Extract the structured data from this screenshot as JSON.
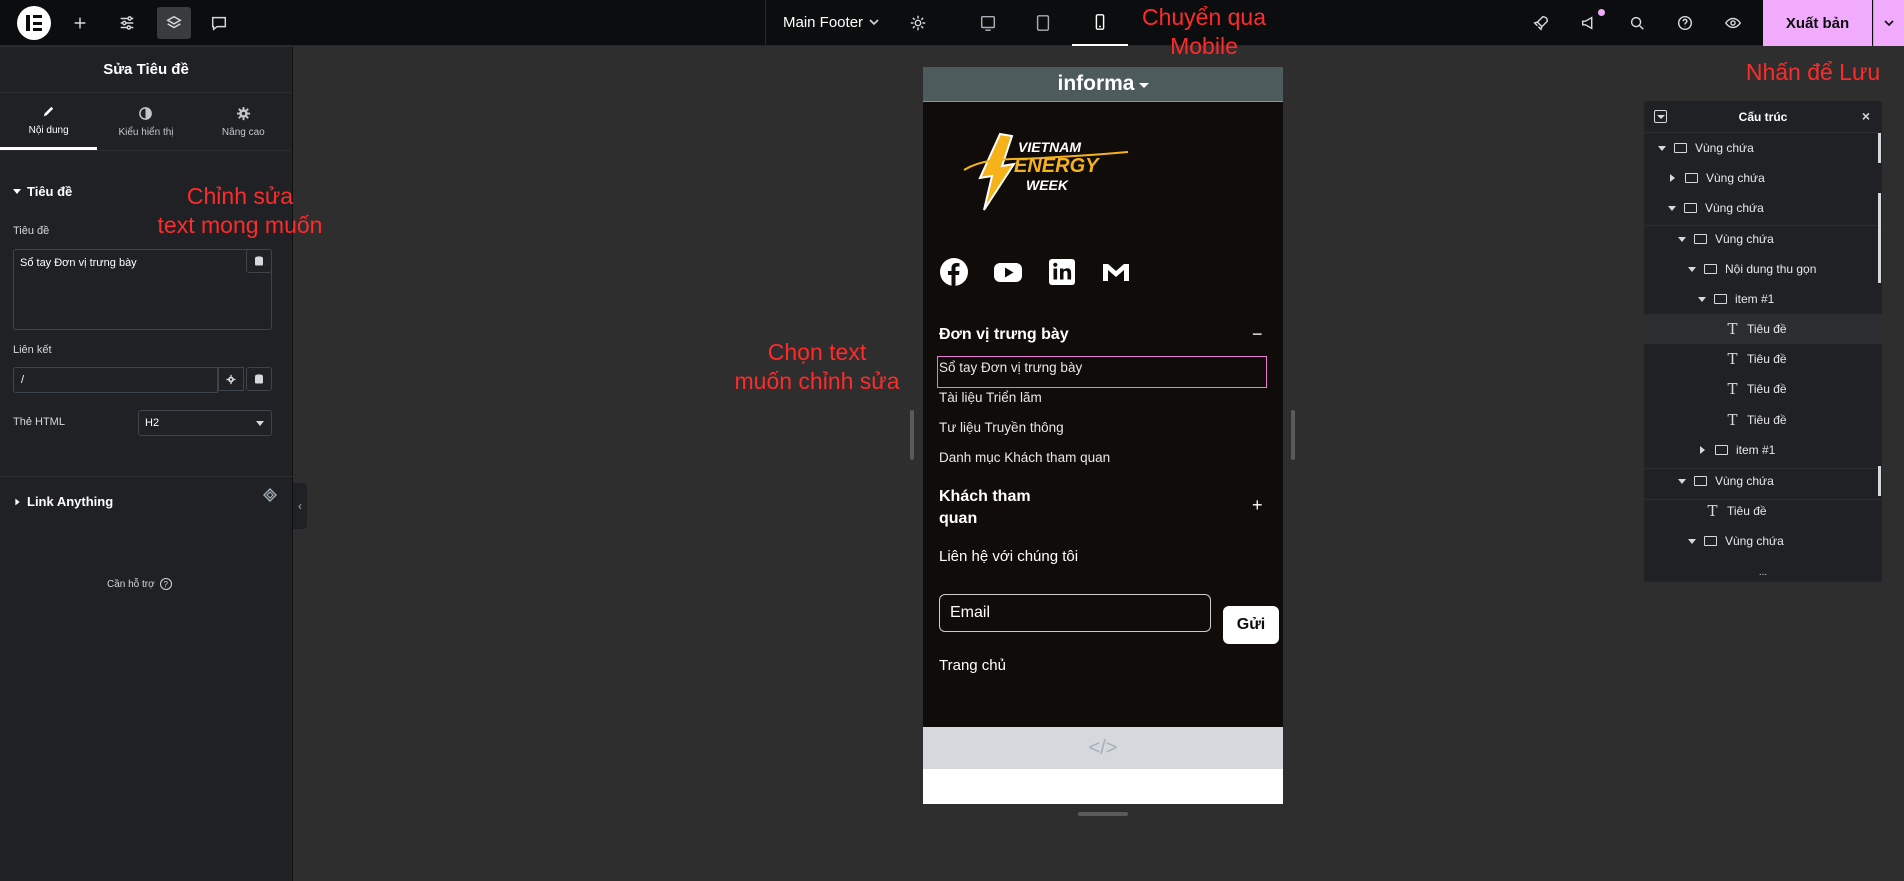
{
  "topbar": {
    "document_title": "Main Footer",
    "publish_label": "Xuất bản",
    "icons": [
      "elementor-logo-icon",
      "plus-icon",
      "sliders-icon",
      "layers-icon",
      "comment-icon",
      "gear-icon",
      "desktop-icon",
      "tablet-icon",
      "mobile-icon",
      "rocket-icon",
      "megaphone-icon",
      "search-icon",
      "help-icon",
      "eye-icon",
      "chevron-down-icon"
    ],
    "active_device": "mobile"
  },
  "panel": {
    "title": "Sửa Tiêu đề",
    "tabs": [
      {
        "label": "Nội dung",
        "icon": "pencil-icon"
      },
      {
        "label": "Kiểu hiển thị",
        "icon": "contrast-icon"
      },
      {
        "label": "Nâng cao",
        "icon": "gear-icon"
      }
    ],
    "section_title": "Tiêu đề",
    "title_label": "Tiêu đề",
    "title_value": "Sổ tay Đơn vị trưng bày",
    "link_label": "Liên kết",
    "link_value": "/",
    "html_tag_label": "Thẻ HTML",
    "html_tag_value": "H2",
    "link_anything": "Link Anything",
    "help_text": "Cần hỗ trợ"
  },
  "annotations": {
    "switch_mobile": [
      "Chuyển qua",
      "Mobile"
    ],
    "save": "Nhấn để Lưu",
    "edit_text": [
      "Chỉnh sửa",
      "text mong muốn"
    ],
    "select_text": [
      "Chọn text",
      "muốn chỉnh sửa"
    ]
  },
  "preview": {
    "brand": "informa",
    "logo_text": [
      "VIETNAM",
      "ENERGY",
      "WEEK"
    ],
    "socials": [
      "facebook-icon",
      "youtube-icon",
      "linkedin-icon",
      "gmail-icon"
    ],
    "accordion1_title": "Đơn vị trưng bày",
    "accordion1_items": [
      "Sổ tay Đơn vị trưng bày",
      "Tài liệu Triển lãm",
      "Tư liệu Truyền thông",
      "Danh mục Khách tham quan"
    ],
    "accordion2_title": [
      "Khách tham",
      "quan"
    ],
    "contact": "Liên hệ với chúng tôi",
    "email_placeholder": "Email",
    "send_label": "Gửi",
    "home_link": "Trang chủ",
    "minus_sign": "−",
    "plus_sign": "+",
    "code_glyph": "</>"
  },
  "navigator": {
    "title": "Cấu trúc",
    "close_glyph": "×",
    "more_glyph": "...",
    "rows": [
      {
        "label": "Vùng chứa",
        "type": "container"
      },
      {
        "label": "Vùng chứa",
        "type": "container"
      },
      {
        "label": "Vùng chứa",
        "type": "container"
      },
      {
        "label": "Vùng chứa",
        "type": "container"
      },
      {
        "label": "Nội dung thu gọn",
        "type": "accordion"
      },
      {
        "label": "item #1",
        "type": "container"
      },
      {
        "label": "Tiêu đề",
        "type": "heading"
      },
      {
        "label": "Tiêu đề",
        "type": "heading"
      },
      {
        "label": "Tiêu đề",
        "type": "heading"
      },
      {
        "label": "Tiêu đề",
        "type": "heading"
      },
      {
        "label": "item #1",
        "type": "container"
      },
      {
        "label": "Vùng chứa",
        "type": "container"
      },
      {
        "label": "Tiêu đề",
        "type": "heading"
      },
      {
        "label": "Vùng chứa",
        "type": "container"
      }
    ]
  },
  "colors": {
    "accent": "#f0abfc",
    "annotation": "#ff2b2b",
    "panel": "#1f2124",
    "canvas": "#2e2e2e"
  }
}
